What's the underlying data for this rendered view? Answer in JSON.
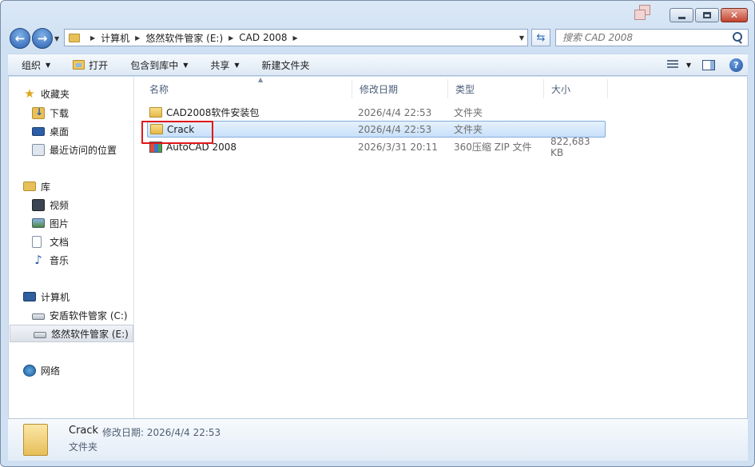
{
  "window": {
    "caption": {
      "minimize": "—",
      "maximize": "□",
      "close": "✕"
    }
  },
  "address": {
    "crumbs": [
      "计算机",
      "悠然软件管家 (E:)",
      "CAD 2008"
    ]
  },
  "search": {
    "placeholder": "搜索 CAD 2008"
  },
  "toolbar": {
    "organize": "组织",
    "open": "打开",
    "include_in_library": "包含到库中",
    "share": "共享",
    "new_folder": "新建文件夹"
  },
  "nav": {
    "favorites_label": "收藏夹",
    "favorites": [
      "下载",
      "桌面",
      "最近访问的位置"
    ],
    "libraries_label": "库",
    "libraries": [
      "视频",
      "图片",
      "文档",
      "音乐"
    ],
    "computer_label": "计算机",
    "drives": [
      "安盾软件管家 (C:)",
      "悠然软件管家 (E:)"
    ],
    "network_label": "网络"
  },
  "columns": {
    "name": "名称",
    "date": "修改日期",
    "type": "类型",
    "size": "大小"
  },
  "files": [
    {
      "name": "CAD2008软件安装包",
      "date": "2026/4/4 22:53",
      "type": "文件夹",
      "size": ""
    },
    {
      "name": "Crack",
      "date": "2026/4/4 22:53",
      "type": "文件夹",
      "size": ""
    },
    {
      "name": "AutoCAD 2008",
      "date": "2026/3/31 20:11",
      "type": "360压缩 ZIP 文件",
      "size": "822,683 KB"
    }
  ],
  "details": {
    "name": "Crack",
    "meta": "修改日期: 2026/4/4 22:53",
    "type": "文件夹"
  },
  "colors": {
    "selection": "#c7e0fa",
    "highlight": "#e0171a"
  }
}
